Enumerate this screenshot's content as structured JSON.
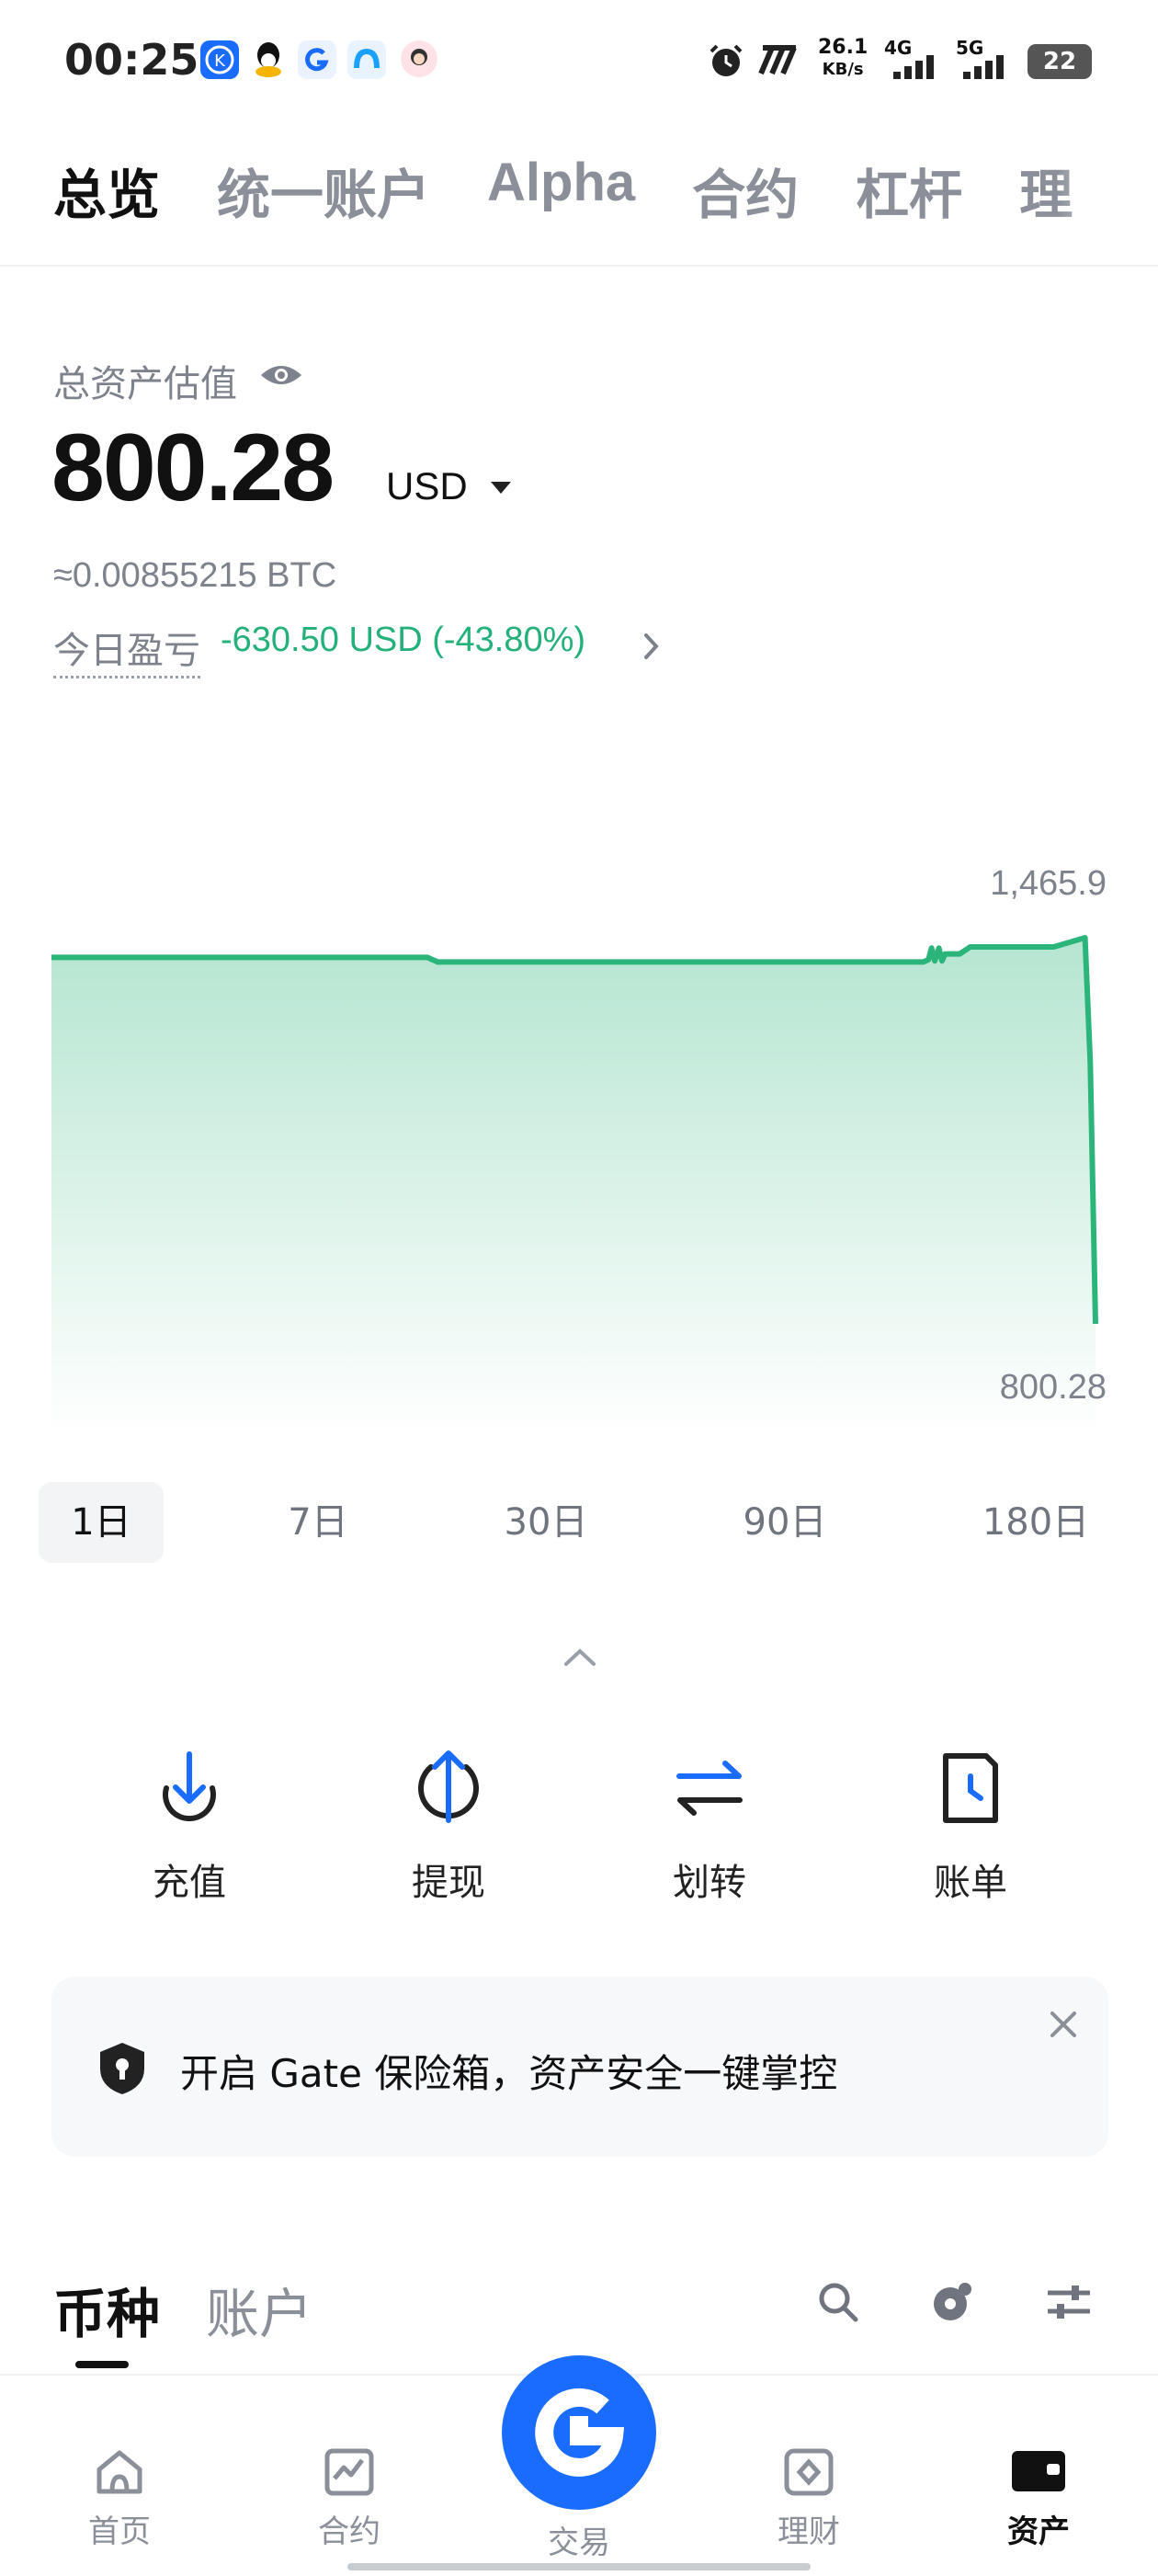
{
  "status_bar": {
    "time": "00:25",
    "net_speed_value": "26.1",
    "net_speed_unit": "KB/s",
    "net_4g": "4G",
    "net_5g": "5G",
    "battery": "22"
  },
  "top_tabs": [
    "总览",
    "统一账户",
    "Alpha",
    "合约",
    "杠杆",
    "理"
  ],
  "overview": {
    "total_label": "总资产估值",
    "total_value": "800.28",
    "currency": "USD",
    "btc_value": "≈0.00855215 BTC",
    "pnl_label": "今日盈亏",
    "pnl_value": "-630.50 USD (-43.80%)",
    "pnl_color": "#23b07a"
  },
  "chart_data": {
    "type": "area",
    "max_label": "1,465.9",
    "min_label": "800.28",
    "values": [
      1432,
      1432,
      1432,
      1432,
      1424,
      1424,
      1424,
      1424,
      1424,
      1424,
      1428,
      1448,
      1426,
      1448,
      1426,
      1438,
      1438,
      1450,
      1450,
      1450,
      1465.9,
      1250,
      800.28
    ],
    "ylim": [
      800.28,
      1465.9
    ],
    "line_color": "#2bb57b"
  },
  "ranges": [
    "1日",
    "7日",
    "30日",
    "90日",
    "180日"
  ],
  "actions": [
    {
      "label": "充值",
      "icon": "deposit-icon"
    },
    {
      "label": "提现",
      "icon": "withdraw-icon"
    },
    {
      "label": "划转",
      "icon": "transfer-icon"
    },
    {
      "label": "账单",
      "icon": "bill-icon"
    }
  ],
  "vault_banner": {
    "text": "开启 Gate 保险箱，资产安全一键掌控"
  },
  "section_tabs": [
    "币种",
    "账户"
  ],
  "bottom_nav": [
    {
      "label": "首页",
      "icon": "home-icon"
    },
    {
      "label": "合约",
      "icon": "futures-icon"
    },
    {
      "label": "交易",
      "icon": "trade-icon"
    },
    {
      "label": "理财",
      "icon": "earn-icon"
    },
    {
      "label": "资产",
      "icon": "assets-icon"
    }
  ],
  "accent_color": "#1a6cff"
}
